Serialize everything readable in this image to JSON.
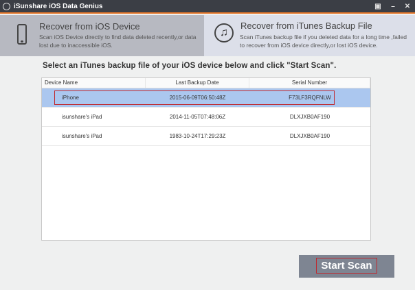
{
  "window": {
    "title": "iSunshare iOS Data Genius",
    "restore": "▣",
    "minimize": "–",
    "close": "✕"
  },
  "modes": [
    {
      "title": "Recover from iOS Device",
      "desc": "Scan iOS Device directly to find data deleted recently,or data lost due to inaccessible iOS."
    },
    {
      "title": "Recover from iTunes Backup File",
      "desc": "Scan iTunes backup file if you deleted data for a long time ,failed to recover from iOS device directly,or lost iOS device."
    }
  ],
  "heading": "Select an iTunes backup file of your iOS device below and click \"Start Scan\".",
  "table": {
    "columns": [
      "Device Name",
      "Last Backup Date",
      "Serial Number"
    ],
    "rows": [
      [
        "iPhone",
        "2015-06-09T06:50:48Z",
        "F73LF3RQFNLW"
      ],
      [
        "isunshare's iPad",
        "2014-11-05T07:48:06Z",
        "DLXJXB0AF190"
      ],
      [
        "isunshare's iPad",
        "1983-10-24T17:29:23Z",
        "DLXJXB0AF190"
      ]
    ]
  },
  "start_scan": "Start Scan"
}
